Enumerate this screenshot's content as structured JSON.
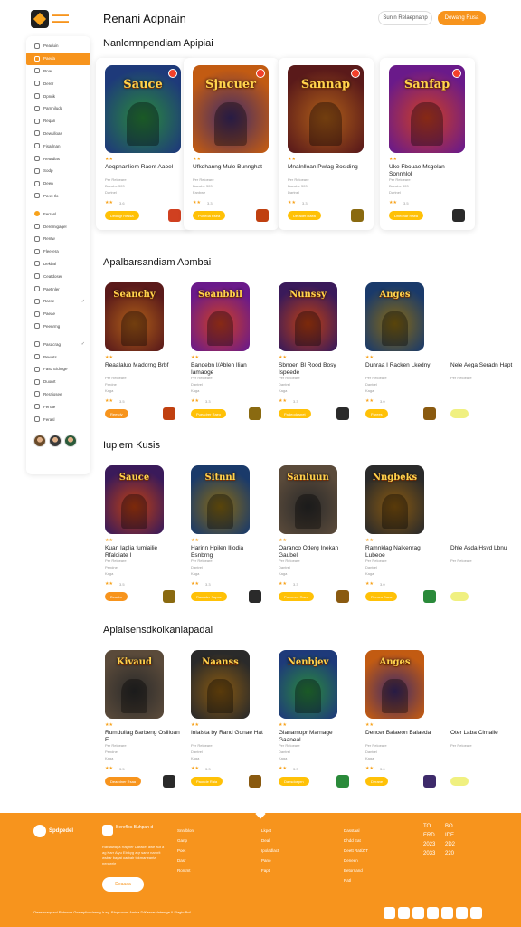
{
  "header": {
    "logo_text": "Renani Adpnain",
    "title": "Renani Adpnain",
    "btn_outline": "Sunin Relaepnanp",
    "btn_primary": "Dowang Rusa",
    "accent": "#f7941d"
  },
  "sidebar": {
    "items": [
      {
        "label": "Peaduin",
        "icon": "home-icon"
      },
      {
        "label": "Paeda",
        "icon": "grid-icon",
        "active": true
      },
      {
        "label": "Rnar",
        "icon": "heart-icon"
      },
      {
        "label": "Derer",
        "icon": "list-icon"
      },
      {
        "label": "Dpnrik",
        "icon": "clock-icon"
      },
      {
        "label": "Pamniludg",
        "icon": "flag-icon"
      },
      {
        "label": "Reqan",
        "icon": "folder-icon"
      },
      {
        "label": "Dewulloas",
        "icon": "download-icon"
      },
      {
        "label": "Fisarlnan",
        "icon": "star-icon"
      },
      {
        "label": "Reurdlas",
        "icon": "chart-icon"
      },
      {
        "label": "Sodp",
        "icon": "tag-icon"
      },
      {
        "label": "Deen",
        "icon": "user-icon"
      },
      {
        "label": "Pa:et Ilo",
        "icon": "settings-icon"
      },
      {
        "label": "Ferranl",
        "icon": "coin-icon",
        "dot": true
      },
      {
        "label": "Deremigagel",
        "icon": "globe-icon"
      },
      {
        "label": "Rentw",
        "icon": "bell-icon"
      },
      {
        "label": "Fleerera",
        "icon": "mail-icon"
      },
      {
        "label": "Dekbal",
        "icon": "shield-icon"
      },
      {
        "label": "Ceatdoser",
        "icon": "book-icon"
      },
      {
        "label": "Paetinler",
        "icon": "music-icon"
      },
      {
        "label": "Raroe",
        "icon": "camera-icon",
        "chev": true
      },
      {
        "label": "Paeae",
        "icon": "cloud-icon"
      },
      {
        "label": "Peenrmg",
        "icon": "map-icon"
      },
      {
        "label": "Pasacrag",
        "icon": "key-icon",
        "chev": true
      },
      {
        "label": "Pewets",
        "icon": "lock-icon"
      },
      {
        "label": "Fasd Eidmge",
        "icon": "trophy-icon"
      },
      {
        "label": "Duonrt",
        "icon": "gift-icon"
      },
      {
        "label": "Reraiosee",
        "icon": "help-icon"
      },
      {
        "label": "Ferrae",
        "icon": "info-icon"
      },
      {
        "label": "Ferasl",
        "icon": "logout-icon"
      }
    ]
  },
  "sections": [
    {
      "title": "Nanlomnpendiam Apipiai",
      "cards": [
        {
          "art": "Sauce",
          "title": "Aeqpnanliem Raent Aaoel",
          "sub1": "Per Reloeare",
          "sub2": "Baeabe 303",
          "sub3": "Dartnel",
          "rating": "3.6",
          "pill": "Dedngr Ressa"
        },
        {
          "art": "Sjncuer",
          "title": "Ufkdhanng Mule Bunnghat",
          "sub1": "Per Reloeare",
          "sub2": "Baeabe 303",
          "sub3": "Fanbwe",
          "rating": "3.3",
          "pill": "Puneda Rsea"
        },
        {
          "art": "Sannap",
          "title": "Mnalnlloan Pwlag Bosiding",
          "sub1": "Per Reloeare",
          "sub2": "Baeabe 303",
          "sub3": "Dartnel",
          "rating": "3.3",
          "pill": "Deradet Raea"
        },
        {
          "art": "Sanfap",
          "title": "Uke Fbouae Msgelan Sonnhlol",
          "sub1": "Per Reloeare",
          "sub2": "Baeabe 303",
          "sub3": "Dartnel",
          "rating": "3.5",
          "pill": "Dnednar Raea"
        }
      ]
    },
    {
      "title": "Apalbarsandiam Apmbai",
      "cards": [
        {
          "art": "Seanchy",
          "title": "Reaalaluo Madorng Brbf",
          "sub1": "Per Reloeare",
          "sub2": "Pardne",
          "sub3": "Kaga",
          "rating": "3.5",
          "pill": "Reesdy"
        },
        {
          "art": "Seanbbil",
          "title": "Bandebn I/Ablen Ilian Iamaoge",
          "sub1": "Per Reloeare",
          "sub2": "Dantrel",
          "sub3": "Kaga",
          "rating": "3.3",
          "pill": "Pueadrer Raeo"
        },
        {
          "art": "Nunssy",
          "title": "Sbnoen Bl Rood Bosy Ispeede",
          "sub1": "Per Reloeare",
          "sub2": "Dantrel",
          "sub3": "Kaga",
          "rating": "3.3",
          "pill": "Padeodasnet"
        },
        {
          "art": "Anges",
          "title": "Dunraa I Racken Lkedny",
          "sub1": "Per Reloeare",
          "sub2": "Dantrel",
          "sub3": "Kaga",
          "rating": "3.0",
          "pill": "Parees"
        },
        {
          "art": "",
          "title": "Nele Aega Seradn Hapt",
          "sub1": "Per Reloeare",
          "sub2": "",
          "sub3": "",
          "rating": "",
          "pill": ""
        }
      ]
    },
    {
      "title": "Iuplem Kusis",
      "cards": [
        {
          "art": "Sauce",
          "title": "Kuan Iaplia fumiailie Rfaloiate I",
          "sub1": "Per Reloeare",
          "sub2": "Pendne",
          "sub3": "Kaga",
          "rating": "3.5",
          "pill": "Deadnr"
        },
        {
          "art": "Sitnnl",
          "title": "Harinn Hpilen Iliodia Esnbrng",
          "sub1": "Per Reloeare",
          "sub2": "Dantrel",
          "sub3": "Kaga",
          "rating": "3.3",
          "pill": "Raouder Sapoe"
        },
        {
          "art": "Sanluun",
          "title": "Oaranco Oderg Inekan Gaubel",
          "sub1": "Per Reloeare",
          "sub2": "Dantrel",
          "sub3": "Kaga",
          "rating": "3.3",
          "pill": "Paroeree Raeo"
        },
        {
          "art": "Nngbeks",
          "title": "Ramnklag Nalkenrag Lubeoe",
          "sub1": "Per Reloeare",
          "sub2": "Dantrel",
          "sub3": "Kaga",
          "rating": "3.0",
          "pill": "Reroes Eaea"
        },
        {
          "art": "",
          "title": "Dhle Asda Hsvd Lbnu",
          "sub1": "Per Reloeare",
          "sub2": "",
          "sub3": "",
          "rating": "",
          "pill": ""
        }
      ]
    },
    {
      "title": "Aplalsensdkolkanlapadal",
      "cards": [
        {
          "art": "Kivaud",
          "title": "Rumduliag Barbeng Osilloan E",
          "sub1": "Per Reloeare",
          "sub2": "Pendne",
          "sub3": "Kaga",
          "rating": "3.5",
          "pill": "Deaedner Rsaa"
        },
        {
          "art": "Naanss",
          "title": "Inlaista by Rand Gonae Hat",
          "sub1": "Per Reloeare",
          "sub2": "Dantrel",
          "sub3": "Kaga",
          "rating": "3.3",
          "pill": "Paonde Raia"
        },
        {
          "art": "Nenbjev",
          "title": "Glanamopr Marnage Gaaneal",
          "sub1": "Per Reloeare",
          "sub2": "Dantrel",
          "sub3": "Kaga",
          "rating": "3.3",
          "pill": "Dansdosprn"
        },
        {
          "art": "Anges",
          "title": "Dencer Balaeon Balaeda",
          "sub1": "Per Reloeare",
          "sub2": "Dantrel",
          "sub3": "Kaga",
          "rating": "3.0",
          "pill": "Derane"
        },
        {
          "art": "",
          "title": "Oter Laba Cirnaile",
          "sub1": "Per Reloeare",
          "sub2": "",
          "sub3": "",
          "rating": "",
          "pill": ""
        }
      ]
    }
  ],
  "footer": {
    "logo": "Spdpedel",
    "brand": "Bereflos Buhpan d",
    "desc": "Rardawaga Ragner Daraket awe aut a ag Karr Alyu Ebtkyg aqr samr narbrit wsbar bagat oarbalr tnkmaneanta nerawrle",
    "button": "Deaaaa",
    "col1": [
      "Snrdblon",
      "Ganp",
      "Poet",
      "Dasr",
      "Rontmt"
    ],
    "col2": [
      "Lkpet",
      "Deal",
      "Ipoladlact",
      "Pano",
      "Fapt"
    ],
    "col3": [
      "Dasstaal",
      "Dhdd Eat",
      "Deett Rat/Z.T",
      "Deneen",
      "Betornand",
      "Ratl"
    ],
    "grid": [
      "TO",
      "BO",
      "ERD",
      "IDE",
      "2023",
      "2D2",
      "2033",
      "220"
    ],
    "copyright": "Oeeeaoarpraol Ruhsrmr Gsereplicudarmg Ir eg. Blnpronom Amisa D/Kaeraralatemge II Slagin Bnf",
    "social": [
      "ig",
      "tw",
      "fb",
      "yt",
      "dc",
      "tk",
      "ig2"
    ]
  }
}
